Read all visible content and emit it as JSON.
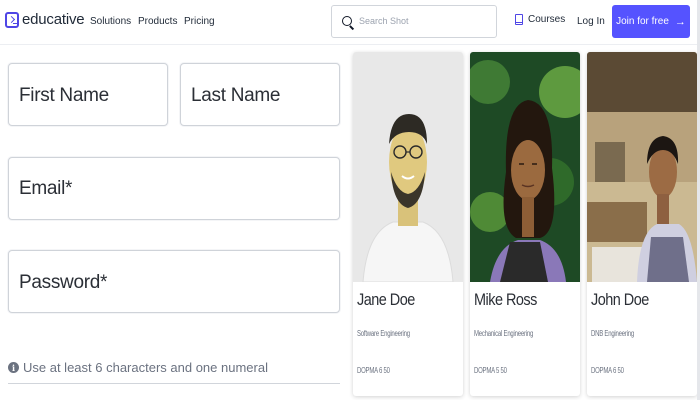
{
  "header": {
    "brand": "educative",
    "nav": [
      "Solutions",
      "Products",
      "Pricing"
    ],
    "search_placeholder": "Search Shot",
    "courses_label": "Courses",
    "login_label": "Log In",
    "cta_label": "Join for free",
    "cta_arrow": "→",
    "icons": {
      "brand": "terminal-logo-icon",
      "search": "search-icon",
      "courses": "book-icon",
      "cta": "arrow-right-icon"
    },
    "accent_color": "#5553ff"
  },
  "form": {
    "first_name": "First Name",
    "last_name": "Last Name",
    "email": "Email*",
    "password": "Password*",
    "hint": "Use at least 6 characters and one numeral",
    "hint_icon": "info-icon"
  },
  "cards": [
    {
      "name": "Jane Doe",
      "role": "Software Engineering",
      "meta": "DOPMA 6 50"
    },
    {
      "name": "Mike Ross",
      "role": "Mechanical Engineering",
      "meta": "DOPMA 5 50"
    },
    {
      "name": "John Doe",
      "role": "DNB Engineering",
      "meta": "DOPMA 6 50"
    }
  ]
}
